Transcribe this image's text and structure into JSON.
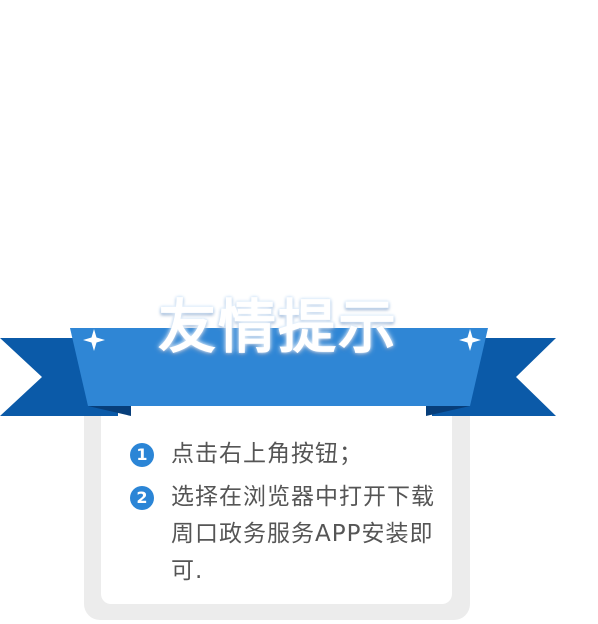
{
  "colors": {
    "ribbon_front": "#2f86d5",
    "ribbon_back": "#0b5aa8",
    "ribbon_fold": "#073e7a",
    "badge": "#2b85d6",
    "text": "#555555",
    "card_border": "#ececec"
  },
  "title": "友情提示",
  "tips": [
    {
      "number": "1",
      "text": "点击右上角按钮；"
    },
    {
      "number": "2",
      "text": "选择在浏览器中打开下载周口政务服务APP安装即可."
    }
  ],
  "icons": {
    "left_sparkle": "sparkle-icon",
    "right_sparkle": "sparkle-icon"
  }
}
